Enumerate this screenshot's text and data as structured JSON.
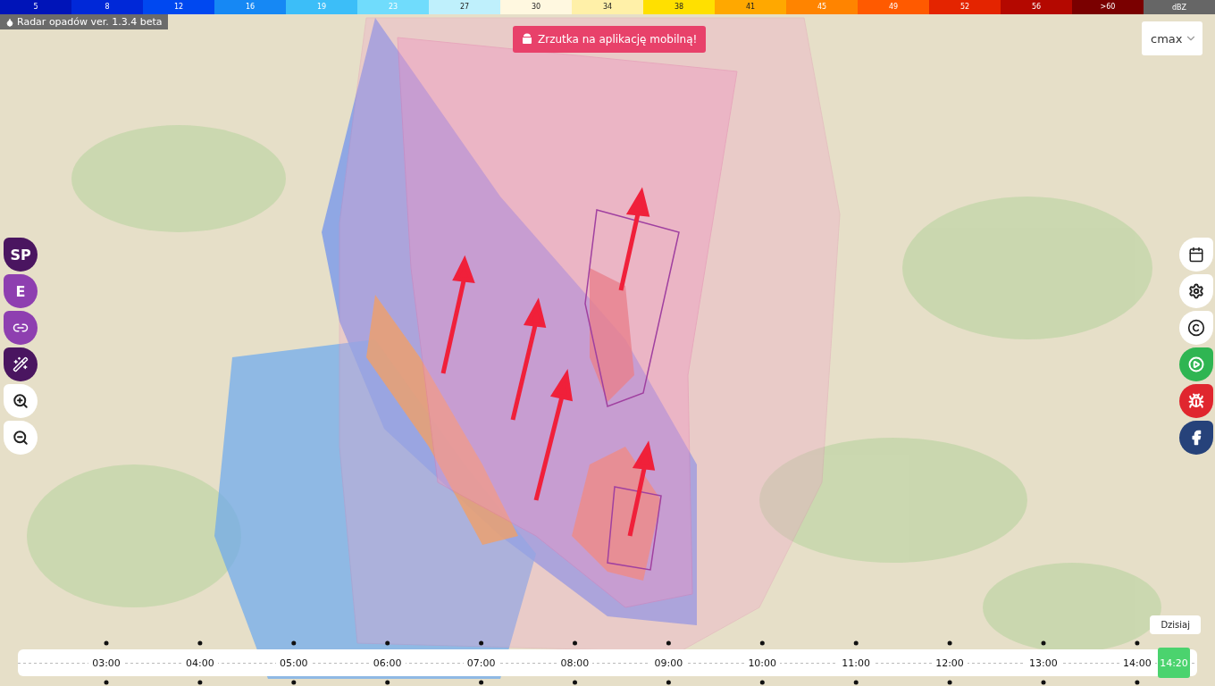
{
  "legend": {
    "ticks": [
      {
        "label": "5",
        "color": "#0014b8"
      },
      {
        "label": "8",
        "color": "#0028d8"
      },
      {
        "label": "12",
        "color": "#0048f0"
      },
      {
        "label": "16",
        "color": "#1688f4"
      },
      {
        "label": "19",
        "color": "#3cbef8"
      },
      {
        "label": "23",
        "color": "#70dcfc"
      },
      {
        "label": "27",
        "color": "#bff0fc"
      },
      {
        "label": "30",
        "color": "#fff8e0"
      },
      {
        "label": "34",
        "color": "#fff0a8"
      },
      {
        "label": "38",
        "color": "#ffe000"
      },
      {
        "label": "41",
        "color": "#ffa800"
      },
      {
        "label": "45",
        "color": "#ff8400"
      },
      {
        "label": "49",
        "color": "#ff5a00"
      },
      {
        "label": "52",
        "color": "#e42400"
      },
      {
        "label": "56",
        "color": "#b40800"
      },
      {
        "label": ">60",
        "color": "#7a0000"
      }
    ],
    "unit": "dBZ"
  },
  "version": "Radar opadów ver. 1.3.4 beta",
  "app_banner": "Zrzutka na aplikację mobilną!",
  "product_select": {
    "value": "cmax"
  },
  "left_tools": [
    {
      "kind": "text",
      "label": "SP",
      "color": "#4a1560"
    },
    {
      "kind": "text",
      "label": "E",
      "color": "#8e3fb0"
    },
    {
      "kind": "link",
      "color": "#8e3fb0"
    },
    {
      "kind": "wand",
      "color": "#4a1560"
    },
    {
      "kind": "zoom_in",
      "color": "#ffffff"
    },
    {
      "kind": "zoom_out",
      "color": "#ffffff"
    }
  ],
  "right_tools": [
    {
      "kind": "calendar",
      "color": "#ffffff"
    },
    {
      "kind": "settings",
      "color": "#ffffff"
    },
    {
      "kind": "copyright",
      "color": "#ffffff"
    },
    {
      "kind": "play",
      "color": "#2fb552"
    },
    {
      "kind": "bug",
      "color": "#e0262e"
    },
    {
      "kind": "facebook",
      "color": "#26427a"
    }
  ],
  "timeline": {
    "hours": [
      "03:00",
      "04:00",
      "05:00",
      "06:00",
      "07:00",
      "08:00",
      "09:00",
      "10:00",
      "11:00",
      "12:00",
      "13:00",
      "14:00"
    ],
    "current": "14:20",
    "tooltip": "Dzisiaj"
  }
}
